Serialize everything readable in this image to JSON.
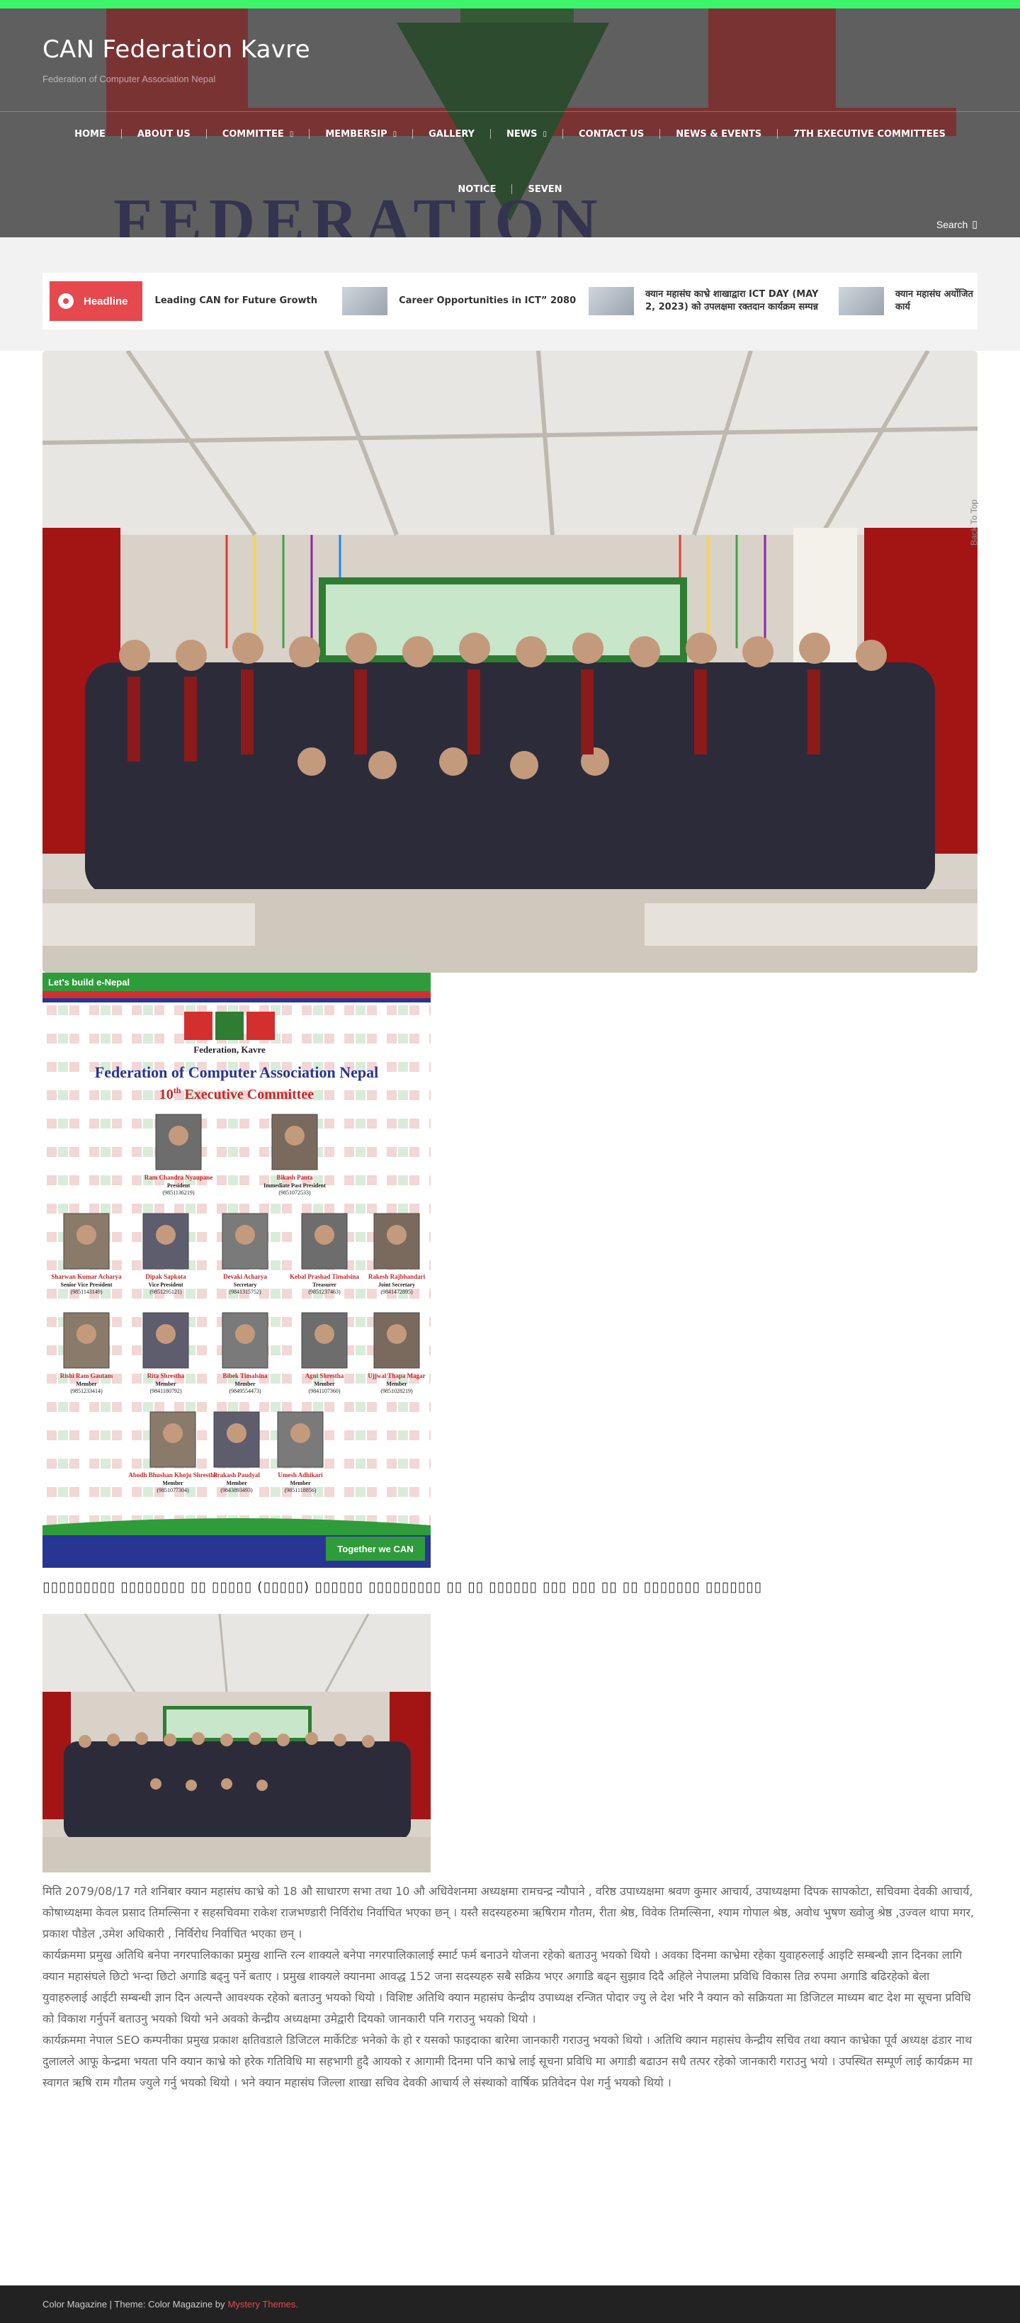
{
  "site": {
    "title": "CAN Federation Kavre",
    "tagline": "Federation of Computer Association Nepal"
  },
  "nav": {
    "row1": [
      "HOME",
      "ABOUT US",
      "COMMITTEE",
      "MEMBERSIP",
      "GALLERY",
      "NEWS",
      "CONTACT US",
      "NEWS & EVENTS",
      "7TH EXECUTIVE COMMITTEES"
    ],
    "row1_dropdowns": [
      false,
      false,
      true,
      true,
      false,
      true,
      false,
      false,
      false
    ],
    "row2": [
      "NOTICE",
      "SEVEN"
    ],
    "search_label": "Search"
  },
  "ticker": {
    "badge": "Headline",
    "items": [
      "Leading CAN for Future Growth",
      "Career Opportunities in ICT” 2080",
      "क्यान महासंघ काभ्रे शाखाद्वारा ICT DAY (MAY 2, 2023) को उपलक्षमा रक्तदान कार्यक्रम सम्पन्न",
      "क्यान महासंघ अर्योजित कार्य"
    ]
  },
  "poster": {
    "top_banner": "Let's build e-Nepal",
    "logo_text": "Federation, Kavre",
    "title": "Federation of Computer Association Nepal",
    "subtitle_prefix": "10",
    "subtitle_sup": "th",
    "subtitle": "Executive Committee",
    "bottom_banner": "Together we CAN",
    "members": [
      {
        "name": "Ram Chandra Nyaupane",
        "role": "President",
        "phone": "(9851136219)"
      },
      {
        "name": "Bikash Panta",
        "role": "Immediate Past President",
        "phone": "(9851072533)"
      },
      {
        "name": "Sharwan Kumar Acharya",
        "role": "Senior Vice President",
        "phone": "(9851143149)"
      },
      {
        "name": "Dipak Sapkota",
        "role": "Vice President",
        "phone": "(9851295121)"
      },
      {
        "name": "Devaki Acharya",
        "role": "Secretary",
        "phone": "(9841315752)"
      },
      {
        "name": "Kebal Prashad Timalsina",
        "role": "Treasurer",
        "phone": "(9851237463)"
      },
      {
        "name": "Rakesh Rajbhandari",
        "role": "Joint Secretary",
        "phone": "(9841472895)"
      },
      {
        "name": "Rishi Ram Gautam",
        "role": "Member",
        "phone": "(9851233414)"
      },
      {
        "name": "Rita Shrestha",
        "role": "Member",
        "phone": "(9841180792)"
      },
      {
        "name": "Bibek Timalsina",
        "role": "Member",
        "phone": "(9849554473)"
      },
      {
        "name": "Agni Shrestha",
        "role": "Member",
        "phone": "(9841107360)"
      },
      {
        "name": "Ujjwal Thapa Magar",
        "role": "Member",
        "phone": "(9851028219)"
      },
      {
        "name": "Abodh Bhushan Khoju Shrestha",
        "role": "Member",
        "phone": "(9851077304)"
      },
      {
        "name": "Prakash Paudyal",
        "role": "Member",
        "phone": "(9843893493)"
      },
      {
        "name": "Umesh Adhikari",
        "role": "Member",
        "phone": "(9851118856)"
      }
    ]
  },
  "post": {
    "heading": "▯▯▯▯▯▯▯▯▯ ▯▯▯▯▯▯▯▯ ▯▯ ▯▯▯▯▯ (▯▯▯▯▯) ▯▯▯▯▯▯ ▯▯▯▯▯▯▯▯▯ ▯▯ ▯▯ ▯▯▯▯▯▯ ▯▯▯ ▯▯▯ ▯▯ ▯▯ ▯▯▯▯▯▯▯ ▯▯▯▯▯▯▯",
    "paragraphs": [
      "मिति 2079/08/17 गते शनिबार क्यान महासंघ काभ्रे को 18 औ साधारण सभा तथा 10 औ अधिवेशनमा अध्यक्षमा रामचन्द्र न्यौपाने , वरिष्ठ उपाध्यक्षमा श्रवण कुमार आचार्य, उपाध्यक्षमा दिपक सापकोटा, सचिवमा देवकी आचार्य, कोषाध्यक्षमा केवल प्रसाद तिमल्सिना र सहसचिवमा राकेश राजभण्डारी निर्विरोध निर्वाचित भएका छन् । यस्तै सदस्यहरुमा ऋषिराम गौतम, रीता श्रेष्ठ, विवेक तिमल्सिना, श्याम गोपाल श्रेष्ठ, अवोध भुषण ख्वोजु श्रेष्ठ ,उज्वल थापा मगर, प्रकाश पौडेल ,उमेश अधिकारी , निर्विरोध निर्वाचित भएका छन् ।",
      "कार्यक्रममा प्रमुख अतिथि बनेपा नगरपालिकाका प्रमुख शान्ति रत्न शाक्यले बनेपा नगरपालिकालाई स्मार्ट फर्म बनाउने योजना रहेको बताउनु भयको थियो । अवका दिनमा काभ्रेमा रहेका युवाहरुलाई आइटि सम्बन्धी ज्ञान दिनका लागि क्यान महासंघले छिटो भन्दा छिटो अगाडि बढ्नु पर्ने बताए । प्रमुख शाक्यले क्यानमा आवद्ध 152 जना सदस्यहरु सबै सक्रिय भएर अगाडि बढ्न सुझाव दिदै अहिले नेपालमा प्रविधि विकास तिव्र रुपमा अगाडि बढिरहेको बेला युवाहरुलाई आईटी सम्बन्धी ज्ञान दिन अत्यन्तै आवश्यक रहेको बताउनु भयको थियो । विशिष्ट अतिथि क्यान महासंघ केन्द्रीय उपाध्यक्ष रन्जित पोदार ज्यु ले देश भरि नै क्यान को सक्रियता मा डिजिटल माध्यम बाट देश मा सूचना प्रविधि को विकाश गर्नुपर्ने बताउनु भयको थियो भने अवको केन्द्रीय अध्यक्षमा उमेद्वारी दियको जानकारी पनि गराउनु भयको थियो ।",
      "कार्यक्रममा नेपाल SEO कम्पनीका प्रमुख प्रकाश क्षतिवडाले डिजिटल मार्केटिङ भनेको के हो र यसको फाइदाका बारेमा जानकारी गराउनु भयको थियो । अतिथि क्यान महासंघ केन्द्रीय सचिव तथा क्यान काभ्रेका पूर्व अध्यक्ष ढंडार नाथ दुलालले आफू केन्द्रमा भयता पनि क्यान काभ्रे को हरेक गतिविधि मा सहभागी हुदै आयको र आगामी दिनमा पनि काभ्रे लाई सूचना प्रविधि मा अगाडी बढाउन सधै तत्पर रहेको जानकारी गराउनु भयो । उपस्थित सम्पूर्ण लाई कार्यक्रम मा स्वागत ऋषि राम गौतम ज्युले गर्नु भयको थियो । भने क्यान महासंघ जिल्ला शाखा सचिव देवकी आचार्य ले संस्थाको वार्षिक प्रतिवेदन पेश गर्नु भयको थियो ।"
    ]
  },
  "back_to_top": "Back To Top",
  "footer": {
    "text": "Color Magazine | Theme: Color Magazine by",
    "link": "Mystery Themes."
  },
  "colors": {
    "accent": "#e5484d",
    "topbar": "#3cf56a",
    "footer_bg": "#222222"
  }
}
